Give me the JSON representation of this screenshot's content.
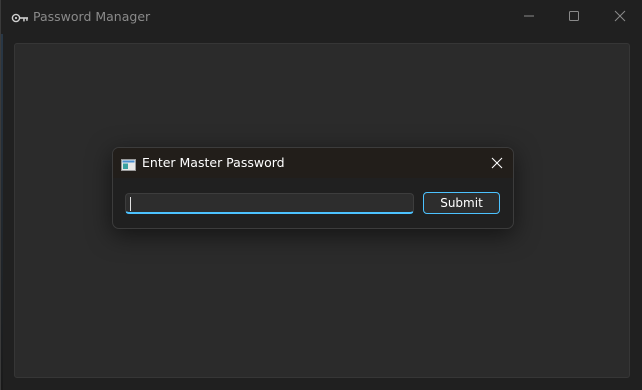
{
  "window": {
    "title": "Password Manager",
    "app_icon": "key-icon",
    "controls": {
      "minimize_icon": "minimize-icon",
      "maximize_icon": "maximize-icon",
      "close_icon": "close-icon"
    }
  },
  "dialog": {
    "title": "Enter Master Password",
    "icon": "window-icon",
    "close_icon": "close-icon",
    "password_value": "",
    "submit_label": "Submit"
  },
  "colors": {
    "accent": "#4cc2ff",
    "window_background": "#202020",
    "panel_background": "#2b2b2b",
    "title_text": "#8a8a8a",
    "dialog_text": "#ffffff"
  }
}
